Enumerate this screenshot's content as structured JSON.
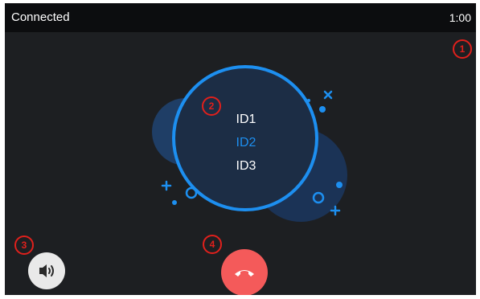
{
  "status_bar": {
    "status": "Connected",
    "timer": "1:00"
  },
  "callers": [
    {
      "label": "ID1",
      "active": false
    },
    {
      "label": "ID2",
      "active": true
    },
    {
      "label": "ID3",
      "active": false
    }
  ],
  "markers": [
    "1",
    "2",
    "3",
    "4"
  ],
  "buttons": {
    "speaker_icon": "speaker-icon",
    "hangup_icon": "hang-up-phone-icon"
  },
  "colors": {
    "accent": "#1d8ff0",
    "hangup": "#f45a5a",
    "annotation": "#e0201c"
  }
}
